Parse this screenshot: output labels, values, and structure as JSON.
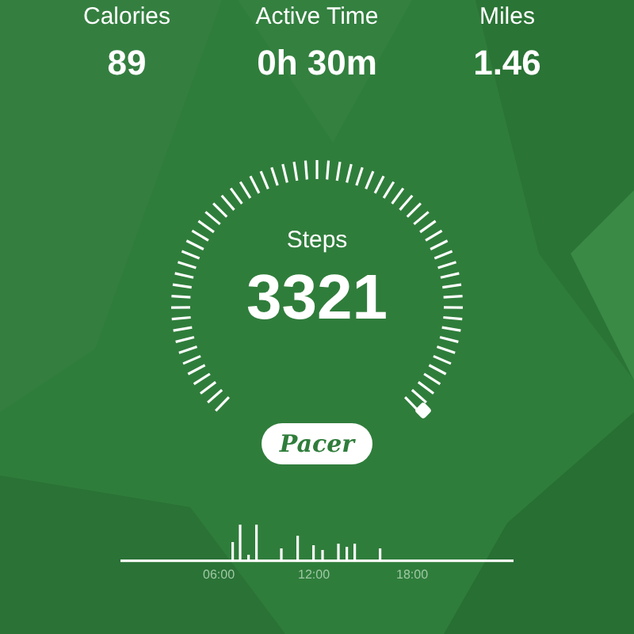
{
  "stats": [
    {
      "label": "Calories",
      "value": "89"
    },
    {
      "label": "Active Time",
      "value": "0h 30m"
    },
    {
      "label": "Miles",
      "value": "1.46"
    }
  ],
  "steps": {
    "label": "Steps",
    "value": "3321"
  },
  "brand_button": "Pacer",
  "timeline": {
    "labels": [
      "06:00",
      "12:00",
      "18:00"
    ]
  }
}
